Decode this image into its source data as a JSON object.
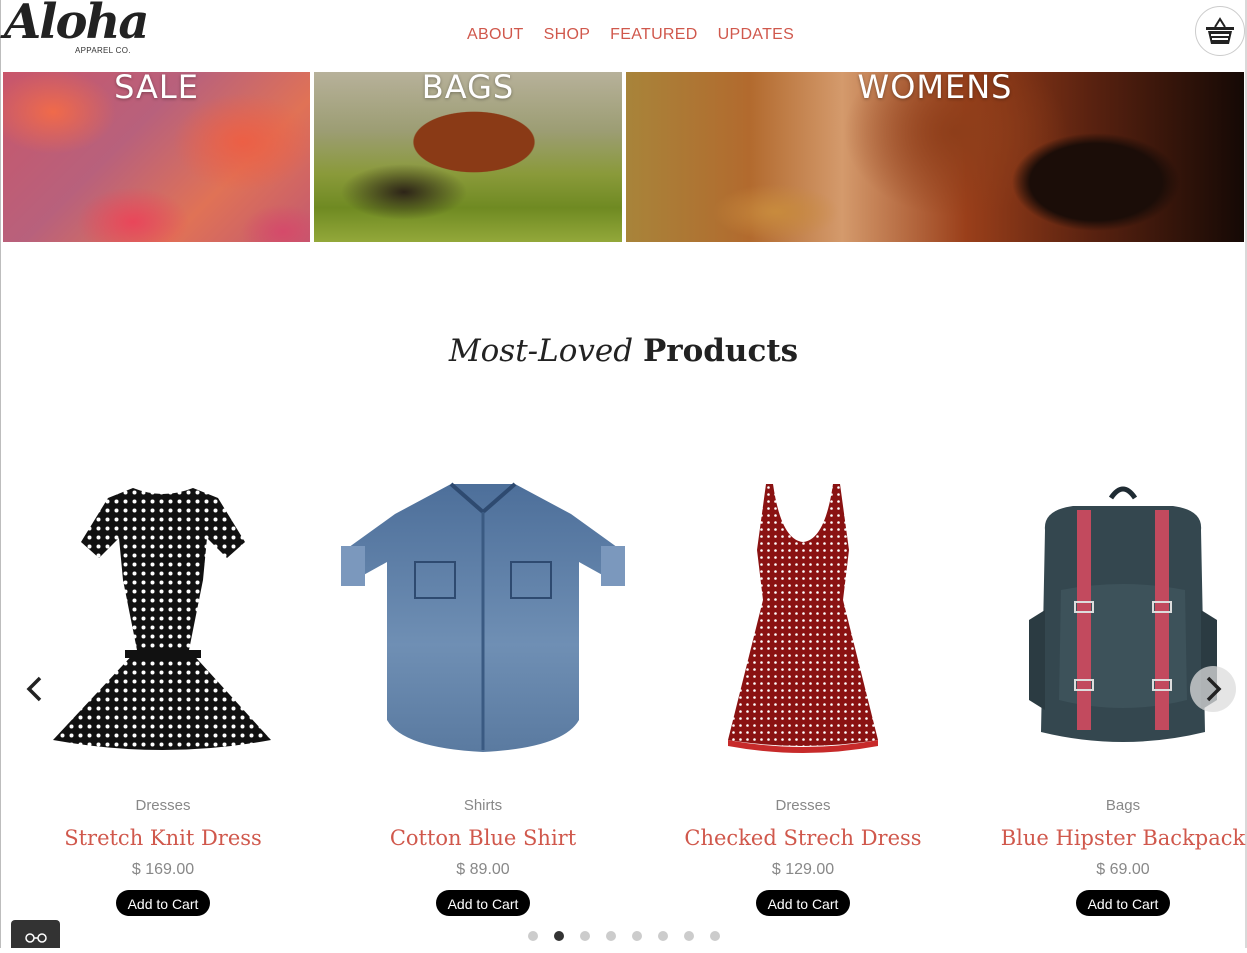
{
  "header": {
    "logo_main": "Aloha",
    "logo_sub": "APPAREL CO.",
    "nav": [
      {
        "label": "ABOUT"
      },
      {
        "label": "SHOP"
      },
      {
        "label": "FEATURED"
      },
      {
        "label": "UPDATES"
      }
    ],
    "cart_icon": "shopping-basket-icon"
  },
  "banners": [
    {
      "label": "SALE"
    },
    {
      "label": "BAGS"
    },
    {
      "label": "WOMENS"
    }
  ],
  "section": {
    "title_italic": "Most-Loved",
    "title_bold": "Products"
  },
  "products": [
    {
      "category": "Dresses",
      "name": "Stretch Knit Dress",
      "price": "$ 169.00",
      "button": "Add to Cart",
      "image": "polka-dot-black-dress"
    },
    {
      "category": "Shirts",
      "name": "Cotton Blue Shirt",
      "price": "$ 89.00",
      "button": "Add to Cart",
      "image": "denim-shirt"
    },
    {
      "category": "Dresses",
      "name": "Checked Strech Dress",
      "price": "$ 129.00",
      "button": "Add to Cart",
      "image": "red-polka-dot-dress"
    },
    {
      "category": "Bags",
      "name": "Blue Hipster Backpack",
      "price": "$ 69.00",
      "button": "Add to Cart",
      "image": "teal-backpack"
    }
  ],
  "carousel": {
    "prev_icon": "chevron-left-icon",
    "next_icon": "chevron-right-icon",
    "dot_count": 8,
    "active_dot": 2
  },
  "colors": {
    "accent": "#d0584c",
    "text": "#222222",
    "muted": "#888888",
    "button_bg": "#000000"
  }
}
